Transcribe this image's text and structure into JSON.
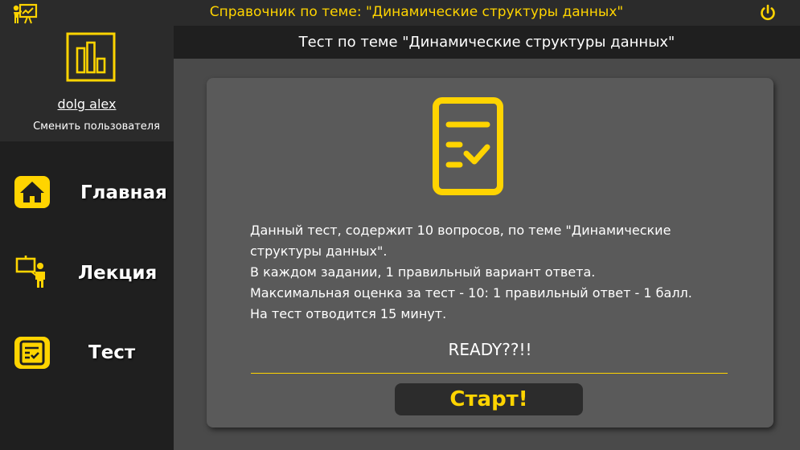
{
  "app": {
    "title": "Справочник по теме: \"Динамические структуры данных\"",
    "accent_color": "#ffd400",
    "icons": {
      "app": "presentation-icon",
      "power": "power-icon"
    }
  },
  "user": {
    "name": "dolg alex",
    "switch_label": "Сменить пользователя",
    "avatar_icon": "bar-chart-icon"
  },
  "nav": {
    "items": [
      {
        "label": "Главная",
        "icon": "home-icon"
      },
      {
        "label": "Лекция",
        "icon": "lecture-icon"
      },
      {
        "label": "Тест",
        "icon": "test-icon"
      }
    ]
  },
  "main": {
    "header_title": "Тест по теме \"Динамические структуры данных\"",
    "card": {
      "icon": "checklist-icon",
      "description_lines": [
        "Данный тест, содержит 10 вопросов, по теме \"Динамические",
        "структуры данных\".",
        "В каждом задании, 1 правильный вариант ответа.",
        "Максимальная оценка за тест - 10: 1 правильный ответ - 1 балл.",
        "На тест отводится 15 минут."
      ],
      "ready_text": "READY??!!",
      "start_label": "Старт!"
    }
  }
}
